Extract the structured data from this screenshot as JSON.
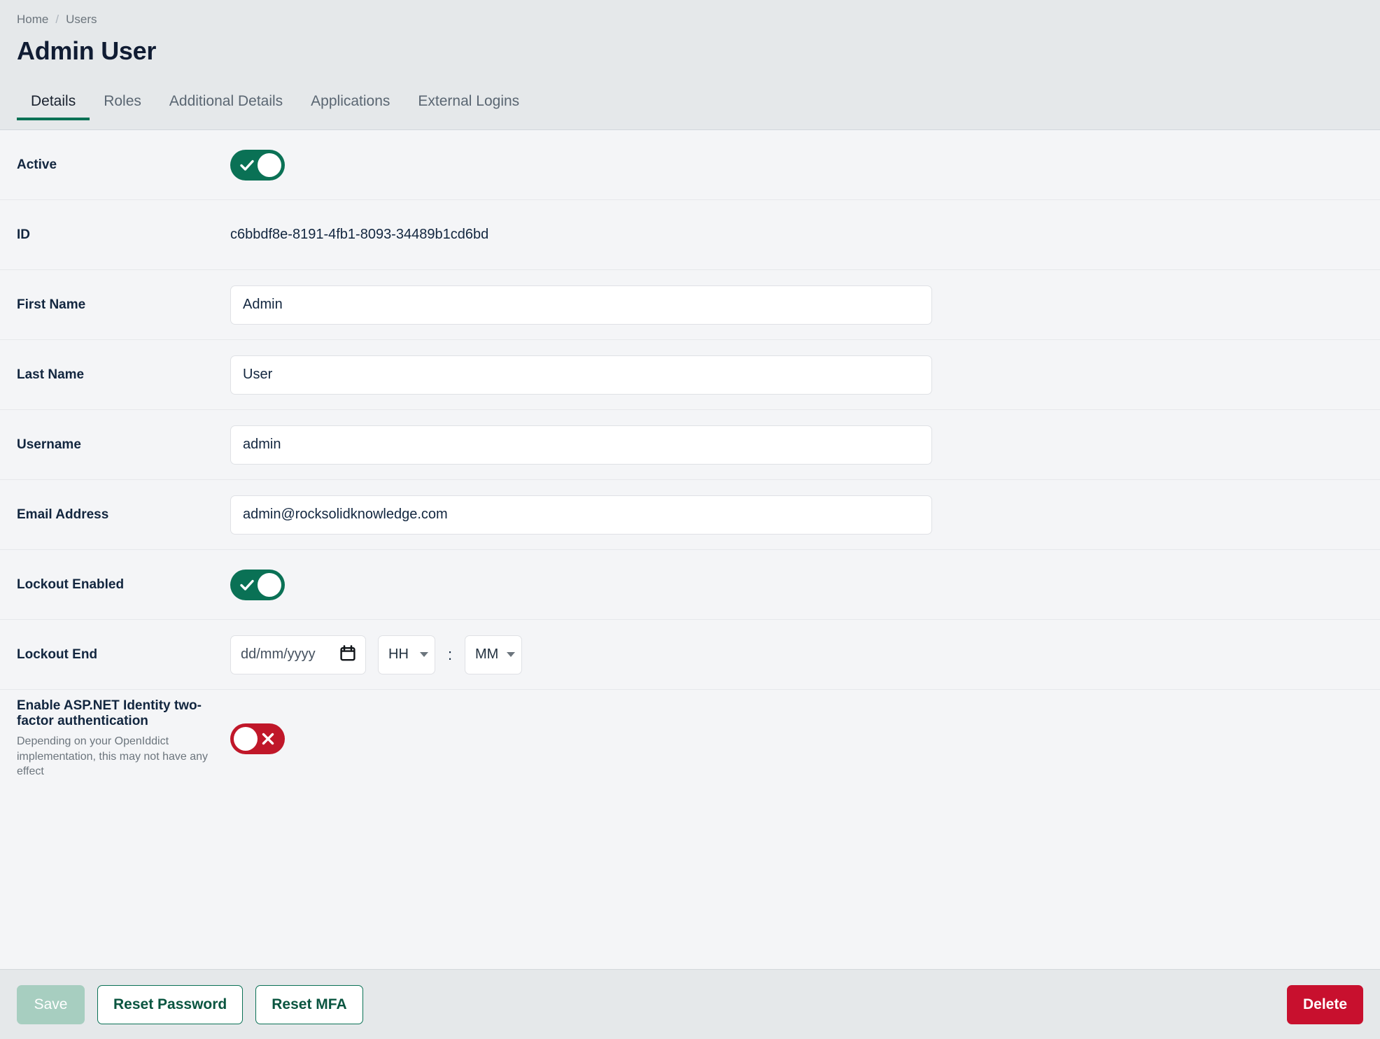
{
  "breadcrumb": {
    "items": [
      "Home",
      "Users"
    ],
    "separator": "/"
  },
  "header": {
    "title": "Admin User"
  },
  "tabs": [
    {
      "label": "Details",
      "active": true
    },
    {
      "label": "Roles",
      "active": false
    },
    {
      "label": "Additional Details",
      "active": false
    },
    {
      "label": "Applications",
      "active": false
    },
    {
      "label": "External Logins",
      "active": false
    }
  ],
  "form": {
    "active": {
      "label": "Active",
      "state": "on",
      "icon": "check-icon"
    },
    "id": {
      "label": "ID",
      "value": "c6bbdf8e-8191-4fb1-8093-34489b1cd6bd"
    },
    "first_name": {
      "label": "First Name",
      "value": "Admin",
      "placeholder": ""
    },
    "last_name": {
      "label": "Last Name",
      "value": "User",
      "placeholder": ""
    },
    "username": {
      "label": "Username",
      "value": "admin",
      "placeholder": ""
    },
    "email": {
      "label": "Email Address",
      "value": "admin@rocksolidknowledge.com",
      "placeholder": ""
    },
    "lockout_enabled": {
      "label": "Lockout Enabled",
      "state": "on",
      "icon": "check-icon"
    },
    "lockout_end": {
      "label": "Lockout End",
      "date_placeholder": "dd/mm/yyyy",
      "date_value": "",
      "hour_value": "HH",
      "minute_value": "MM",
      "time_separator": ":",
      "calendar_icon": "calendar-icon"
    },
    "two_factor": {
      "label": "Enable ASP.NET Identity two-factor authentication",
      "description": "Depending on your OpenIddict implementation, this may not have any effect",
      "state": "off",
      "icon": "close-icon"
    }
  },
  "footer": {
    "save_label": "Save",
    "reset_password_label": "Reset Password",
    "reset_mfa_label": "Reset MFA",
    "delete_label": "Delete"
  },
  "colors": {
    "accent_green": "#0a7155",
    "danger_red": "#c8102e",
    "toggle_off_red": "#c01729",
    "header_bg": "#e5e8ea",
    "content_bg": "#f4f5f7",
    "save_disabled": "#a7cec0"
  }
}
